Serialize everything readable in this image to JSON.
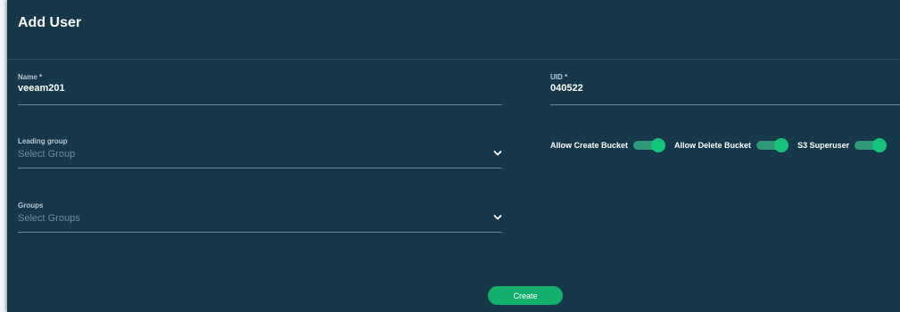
{
  "dialog": {
    "title": "Add User"
  },
  "form": {
    "name": {
      "label": "Name *",
      "value": "veeam201"
    },
    "uid": {
      "label": "UID *",
      "value": "040522"
    },
    "leading_group": {
      "label": "Leading group",
      "placeholder": "Select Group"
    },
    "groups": {
      "label": "Groups",
      "placeholder": "Select Groups"
    }
  },
  "toggles": [
    {
      "label": "Allow Create Bucket",
      "on": true
    },
    {
      "label": "Allow Delete Bucket",
      "on": true
    },
    {
      "label": "S3 Superuser",
      "on": true
    }
  ],
  "actions": {
    "create_label": "Create"
  },
  "colors": {
    "background": "#17384a",
    "accent": "#12b06c",
    "toggle_knob": "#14c47a",
    "text": "#ffffff",
    "muted_text": "#6f8998"
  },
  "icons": {
    "dropdown": "chevron-down-icon"
  }
}
